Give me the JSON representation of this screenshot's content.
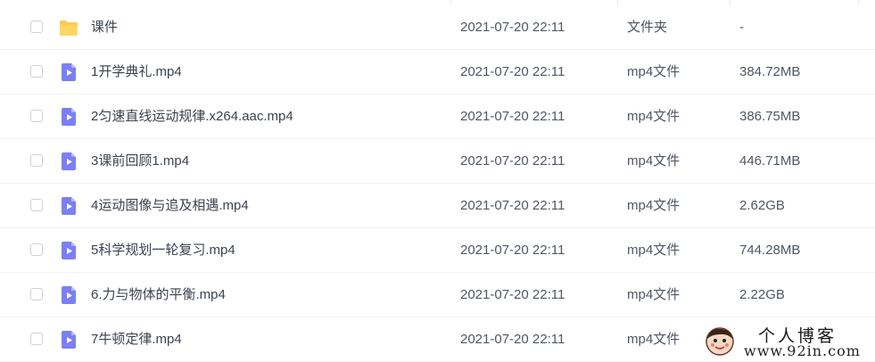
{
  "files": [
    {
      "name": "课件",
      "modified": "2021-07-20 22:11",
      "type": "文件夹",
      "size": "-",
      "icon": "folder-icon"
    },
    {
      "name": "1开学典礼.mp4",
      "modified": "2021-07-20 22:11",
      "type": "mp4文件",
      "size": "384.72MB",
      "icon": "video-file-icon"
    },
    {
      "name": "2匀速直线运动规律.x264.aac.mp4",
      "modified": "2021-07-20 22:11",
      "type": "mp4文件",
      "size": "386.75MB",
      "icon": "video-file-icon"
    },
    {
      "name": "3课前回顾1.mp4",
      "modified": "2021-07-20 22:11",
      "type": "mp4文件",
      "size": "446.71MB",
      "icon": "video-file-icon"
    },
    {
      "name": "4运动图像与追及相遇.mp4",
      "modified": "2021-07-20 22:11",
      "type": "mp4文件",
      "size": "2.62GB",
      "icon": "video-file-icon"
    },
    {
      "name": "5科学规划一轮复习.mp4",
      "modified": "2021-07-20 22:11",
      "type": "mp4文件",
      "size": "744.28MB",
      "icon": "video-file-icon"
    },
    {
      "name": "6.力与物体的平衡.mp4",
      "modified": "2021-07-20 22:11",
      "type": "mp4文件",
      "size": "2.22GB",
      "icon": "video-file-icon"
    },
    {
      "name": "7牛顿定律.mp4",
      "modified": "2021-07-20 22:11",
      "type": "mp4文件",
      "size": "",
      "icon": "video-file-icon"
    }
  ],
  "watermark": {
    "title": "个人博客",
    "url": "www.92in.com"
  },
  "colors": {
    "folder": "#ffc94d",
    "video": "#7b7ff5",
    "row_border": "#f0f2f5"
  }
}
